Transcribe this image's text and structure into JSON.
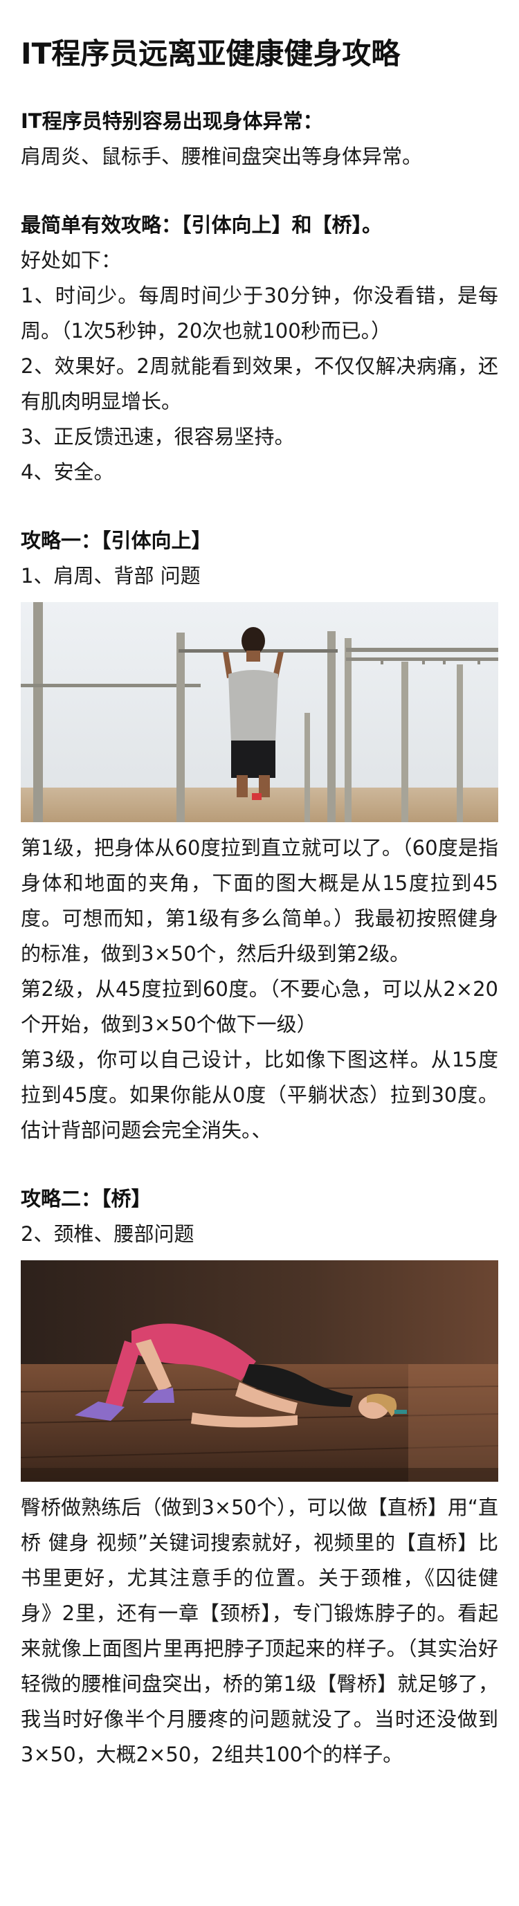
{
  "article": {
    "title": "IT程序员远离亚健康健身攻略",
    "intro": {
      "heading": "IT程序员特别容易出现身体异常：",
      "text": "肩周炎、鼠标手、腰椎间盘突出等身体异常。"
    },
    "summary": {
      "heading": "最简单有效攻略：【引体向上】和【桥】。",
      "benefits_label": "好处如下：",
      "benefits": [
        "1、时间少。每周时间少于30分钟，你没看错，是每周。（1次5秒钟，20次也就100秒而已。）",
        "2、效果好。2周就能看到效果，不仅仅解决病痛，还有肌肉明显增长。",
        "3、正反馈迅速，很容易坚持。",
        "4、安全。"
      ]
    },
    "strategy1": {
      "heading": "攻略一：【引体向上】",
      "subtitle": "1、肩周、背部 问题",
      "paragraphs": [
        "第1级，把身体从60度拉到直立就可以了。（60度是指身体和地面的夹角，下面的图大概是从15度拉到45度。可想而知，第1级有多么简单。）我最初按照健身的标准，做到3×50个，然后升级到第2级。",
        "第2级，从45度拉到60度。（不要心急，可以从2×20个开始，做到3×50个做下一级）",
        "第3级，你可以自己设计，比如像下图这样。从15度拉到45度。如果你能从0度（平躺状态）拉到30度。估计背部问题会完全消失。、"
      ]
    },
    "strategy2": {
      "heading": "攻略二：【桥】",
      "subtitle": "2、颈椎、腰部问题",
      "paragraphs": [
        "臀桥做熟练后（做到3×50个），可以做【直桥】用“直桥 健身 视频”关键词搜索就好，视频里的【直桥】比书里更好，尤其注意手的位置。关于颈椎，《囚徒健身》2里，还有一章【颈桥】，专门锻炼脖子的。看起来就像上面图片里再把脖子顶起来的样子。（其实治好轻微的腰椎间盘突出，桥的第1级【臀桥】就足够了，我当时好像半个月腰疼的问题就没了。当时还没做到3×50，大概2×50，2组共100个的样子。"
      ]
    }
  }
}
